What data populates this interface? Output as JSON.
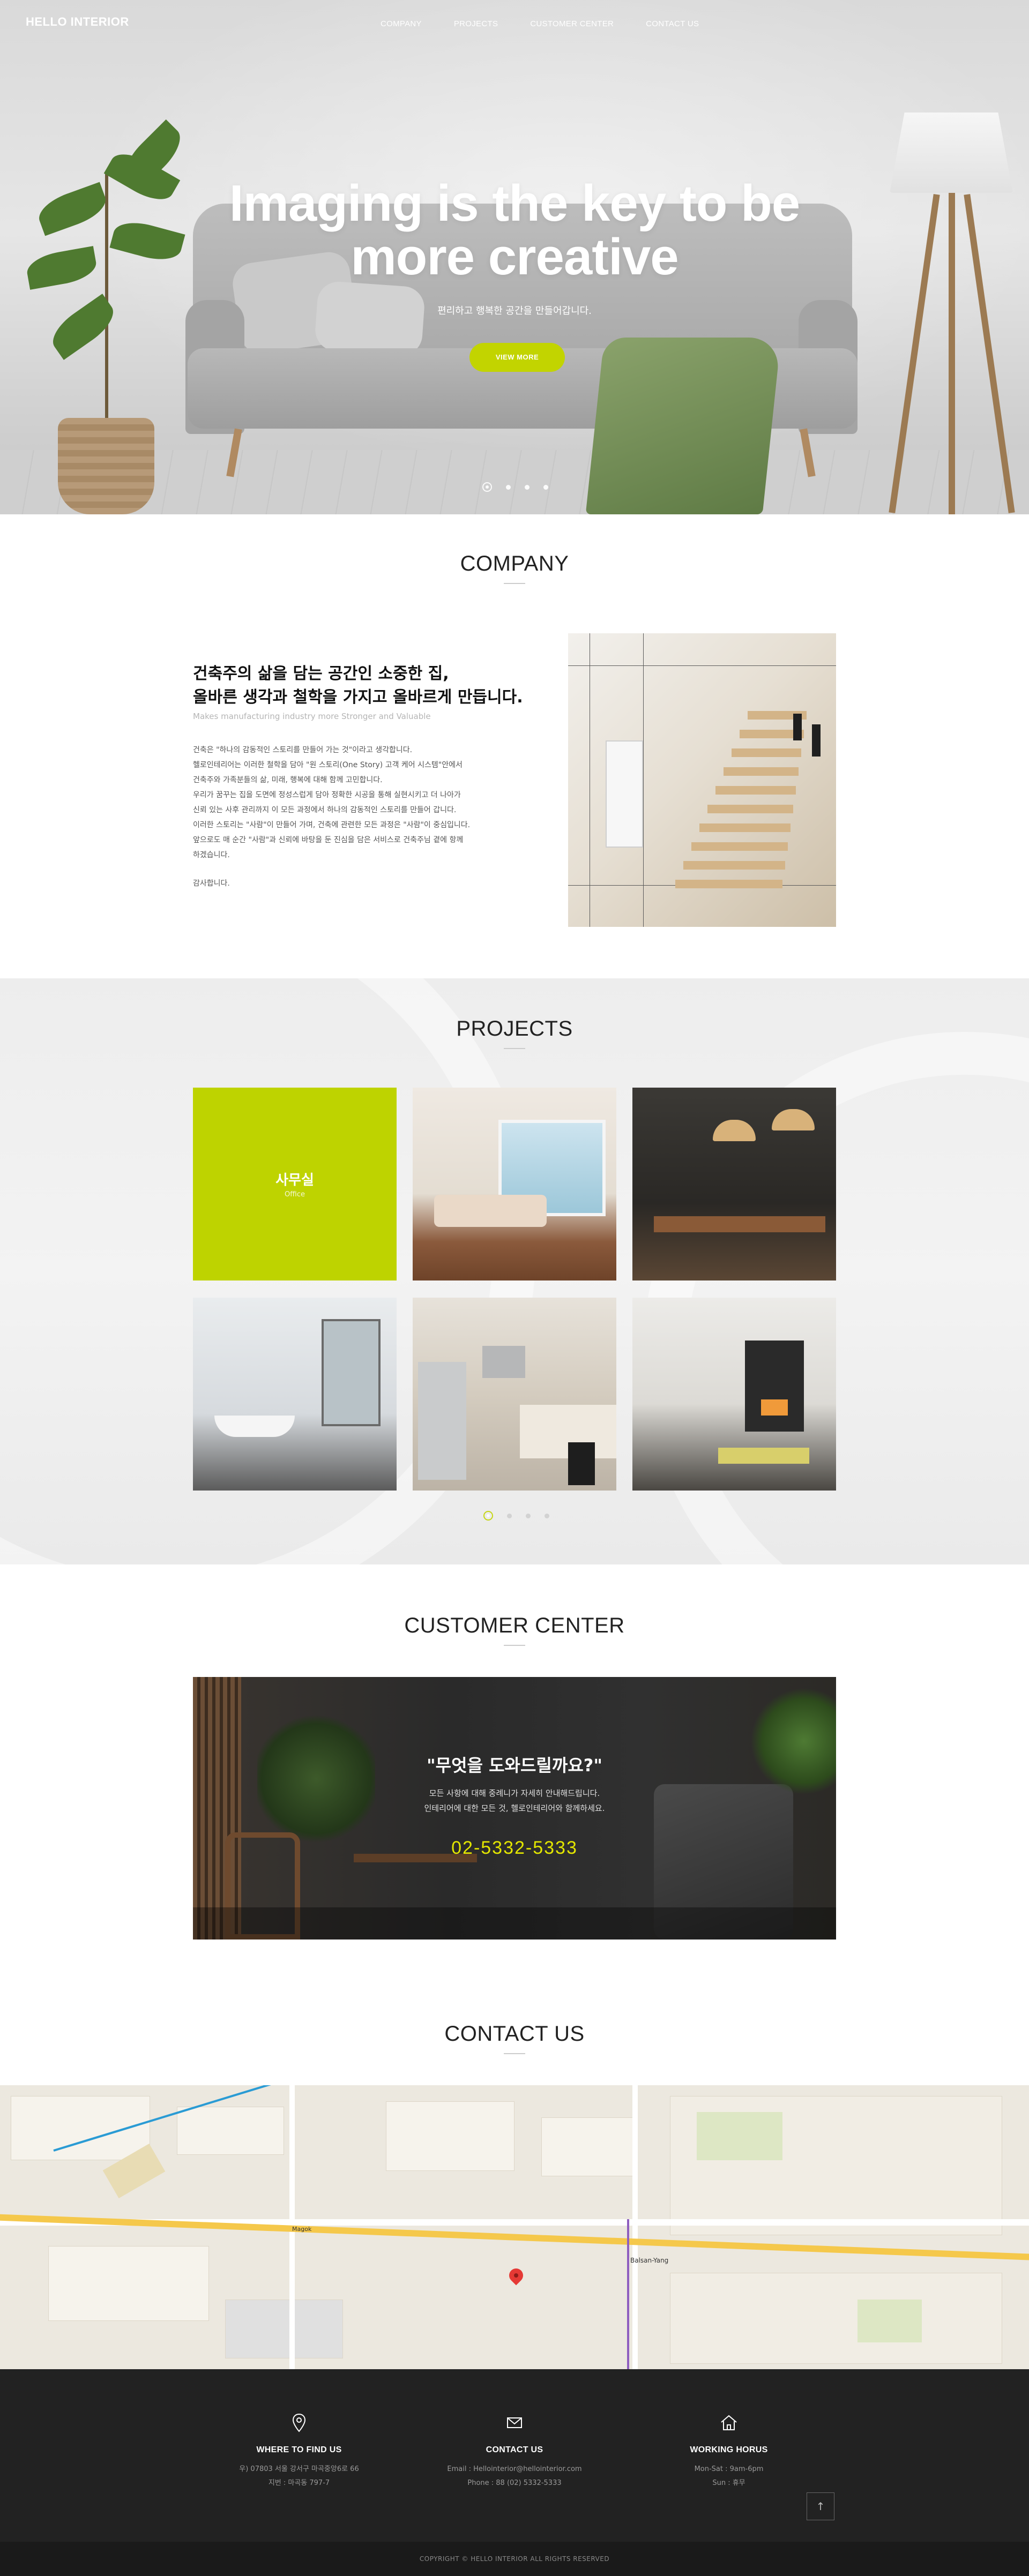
{
  "header": {
    "logo": "HELLO INTERIOR",
    "nav": [
      "COMPANY",
      "PROJECTS",
      "CUSTOMER CENTER",
      "CONTACT US"
    ]
  },
  "hero": {
    "title_line1": "Imaging is the key to be",
    "title_line2": "more creative",
    "subtitle": "편리하고 행복한 공간을 만들어갑니다.",
    "button": "VIEW MORE",
    "slides": 4,
    "active_slide": 1,
    "accent_color": "#c2d400"
  },
  "company": {
    "title": "COMPANY",
    "heading_line1": "건축주의 삶을 담는 공간인 소중한 집,",
    "heading_line2": "올바른 생각과 철학을 가지고 올바르게 만듭니다.",
    "sub": "Makes manufacturing industry more Stronger and Valuable",
    "body": [
      "건축은 \"하나의 감동적인 스토리를 만들어 가는 것\"이라고 생각합니다.",
      "헬로인테리어는 이러한 철학을 담아 \"원 스토리(One Story) 고객 케어 시스템\"안에서",
      "건축주와 가족분들의 삶, 미래, 행복에 대해 함께 고민합니다.",
      "우리가 꿈꾸는 집을 도면에 정성스럽게 담아 정확한 시공을 통해 실현시키고 더 나아가",
      "신뢰 있는 사후 관리까지 이 모든 과정에서 하나의 감동적인 스토리를 만들어 갑니다.",
      "이러한 스토리는 \"사람\"이 만들어 가며, 건축에 관련한 모든 과정은 \"사람\"이 중심입니다.",
      "앞으로도 매 순간 \"사람\"과 신뢰에 바탕을 둔 진심을 담은 서비스로 건축주님 곁에 항께",
      "하겠습니다."
    ],
    "sign": "감사합니다.",
    "image_icon": "staircase-photo"
  },
  "projects": {
    "title": "PROJECTS",
    "featured": {
      "title": "사무실",
      "sub": "Office"
    },
    "tiles": [
      "office",
      "living-room",
      "dining-cafe",
      "bathroom",
      "kitchen",
      "lounge-fireplace"
    ],
    "pages": 4,
    "active_page": 1
  },
  "customer": {
    "title": "CUSTOMER CENTER",
    "quote": "\"무엇을 도와드릴까요?\"",
    "line1": "모든 사항에 대해 중례니가 자세히 안내해드립니다.",
    "line2": "인테리어에 대한 모든 것, 헬로인테리어와 함께하세요.",
    "phone": "02-5332-5333",
    "phone_color": "#e3e600"
  },
  "contact": {
    "title": "CONTACT US",
    "map_labels": [
      "Balsan-Yang",
      "Magok"
    ]
  },
  "footer": {
    "cols": [
      {
        "icon": "location-pin-icon",
        "title": "WHERE TO FIND US",
        "lines": [
          "우) 07803 서울 강서구 마곡중앙6로 66",
          "지번 : 마곡동 797-7"
        ]
      },
      {
        "icon": "mail-icon",
        "title": "CONTACT US",
        "lines": [
          "Email : Hellointerior@hellointerior.com",
          "Phone : 88 (02) 5332-5333"
        ]
      },
      {
        "icon": "home-icon",
        "title": "WORKING HORUS",
        "lines": [
          "Mon-Sat : 9am-6pm",
          "Sun : 휴무"
        ]
      }
    ],
    "top_button": "↑",
    "copyright": "COPYRIGHT © HELLO INTERIOR ALL RIGHTS RESERVED"
  }
}
